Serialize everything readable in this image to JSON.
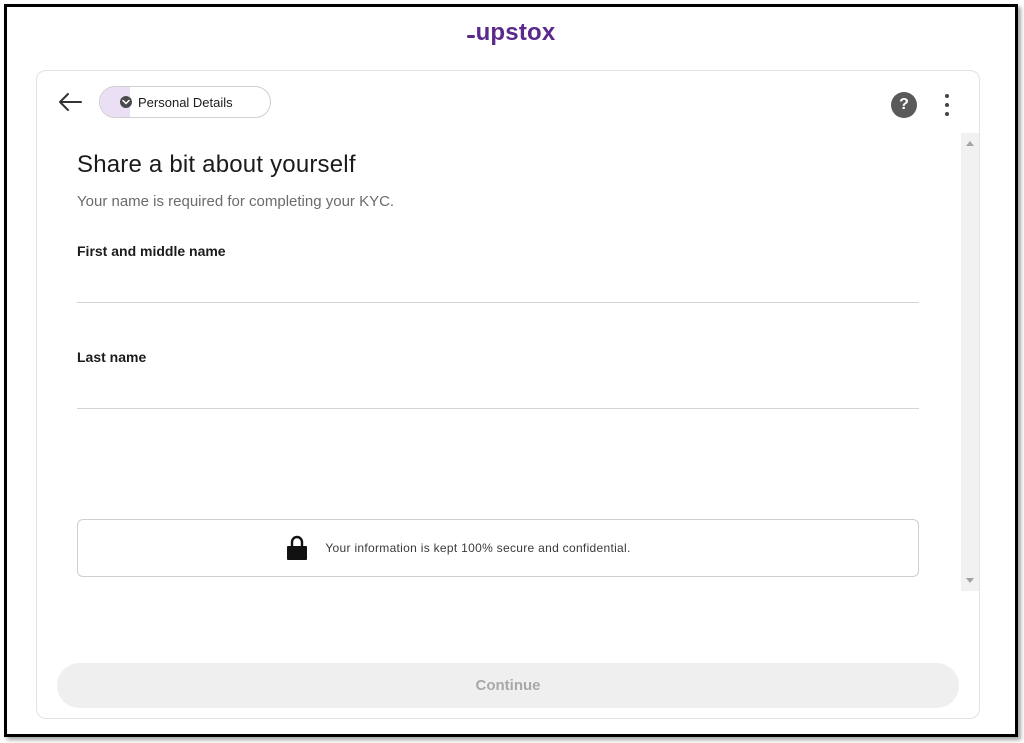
{
  "brand": {
    "name": "upstox",
    "color": "#5a298b"
  },
  "header": {
    "step_chip": "Personal Details",
    "back_icon": "arrow-left-icon",
    "help_icon": "question-icon",
    "help_glyph": "?",
    "more_icon": "kebab-menu-icon"
  },
  "main": {
    "title": "Share a bit about yourself",
    "subtitle": "Your name is required for completing your KYC.",
    "fields": [
      {
        "label": "First and middle name",
        "value": "",
        "placeholder": ""
      },
      {
        "label": "Last name",
        "value": "",
        "placeholder": ""
      }
    ],
    "security_note": "Your information is kept 100% secure and confidential.",
    "security_icon": "lock-icon"
  },
  "footer": {
    "continue_label": "Continue",
    "continue_disabled": true
  },
  "colors": {
    "accent": "#5a298b",
    "chip_fill": "#eadff4",
    "button_disabled_bg": "#efefef",
    "button_disabled_text": "#a8a8a8"
  }
}
